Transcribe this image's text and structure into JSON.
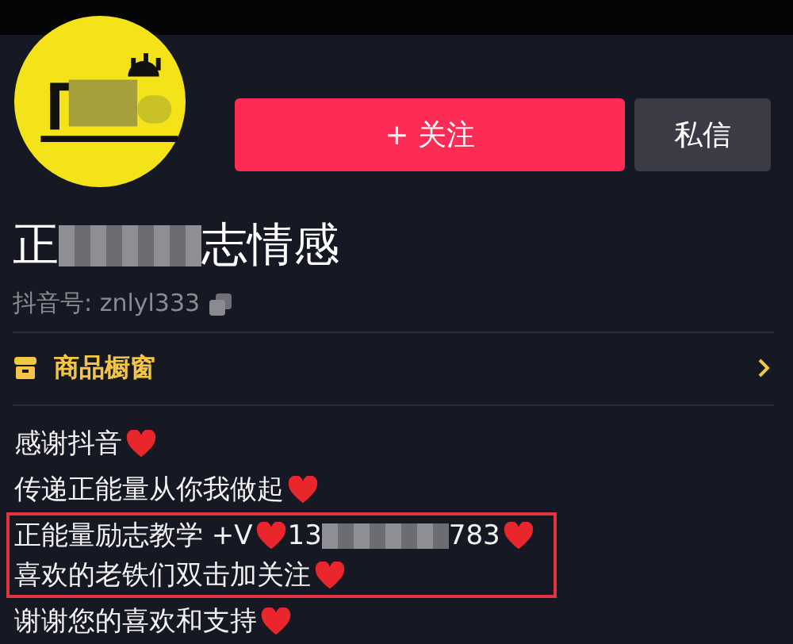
{
  "profile": {
    "follow_button": "+ 关注",
    "message_button": "私信",
    "name": [
      {
        "kind": "text",
        "text": "正"
      },
      {
        "kind": "blur"
      },
      {
        "kind": "text",
        "text": "志情感"
      }
    ],
    "douyin_id": "抖音号: znlyl333"
  },
  "shop_window": {
    "label": "商品橱窗"
  },
  "bio": {
    "lines": [
      {
        "highlighted": false,
        "parts": [
          {
            "kind": "text",
            "text": "感谢抖音"
          },
          {
            "kind": "heart"
          }
        ]
      },
      {
        "highlighted": false,
        "parts": [
          {
            "kind": "text",
            "text": "传递正能量从你我做起"
          },
          {
            "kind": "heart"
          }
        ]
      },
      {
        "highlighted": true,
        "parts": [
          {
            "kind": "text",
            "text": "正能量励志教学 +V"
          },
          {
            "kind": "heart"
          },
          {
            "kind": "text",
            "text": "13"
          },
          {
            "kind": "blur"
          },
          {
            "kind": "text",
            "text": "783"
          },
          {
            "kind": "heart"
          }
        ]
      },
      {
        "highlighted": true,
        "parts": [
          {
            "kind": "text",
            "text": "喜欢的老铁们双击加关注"
          },
          {
            "kind": "heart"
          }
        ]
      },
      {
        "highlighted": false,
        "parts": [
          {
            "kind": "text",
            "text": "谢谢您的喜欢和支持"
          },
          {
            "kind": "heart"
          }
        ]
      }
    ]
  }
}
